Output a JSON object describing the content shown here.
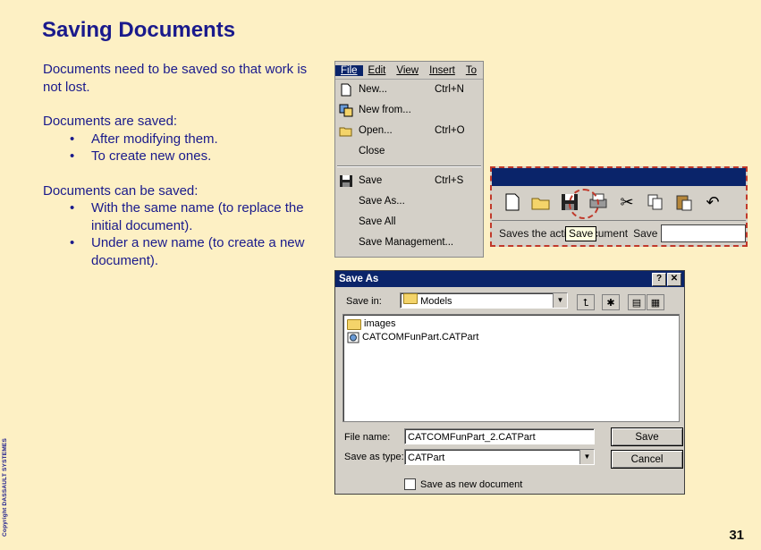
{
  "slide": {
    "title": "Saving Documents",
    "intro": "Documents need to be saved so that work is not lost.",
    "saved_heading": "Documents are saved:",
    "saved_bullets": [
      "After modifying them.",
      "To create new ones."
    ],
    "can_heading": "Documents can be saved:",
    "can_bullets": [
      "With the same name (to replace the initial document).",
      "Under a new name (to create a new document)."
    ],
    "copyright": "Copyright DASSAULT SYSTEMES",
    "page_number": "31"
  },
  "menu": {
    "bar": [
      "File",
      "Edit",
      "View",
      "Insert",
      "To"
    ],
    "items": [
      {
        "label": "New...",
        "accel": "Ctrl+N"
      },
      {
        "label": "New from...",
        "accel": ""
      },
      {
        "label": "Open...",
        "accel": "Ctrl+O"
      },
      {
        "label": "Close",
        "accel": ""
      },
      {
        "label": "Save",
        "accel": "Ctrl+S"
      },
      {
        "label": "Save As...",
        "accel": ""
      },
      {
        "label": "Save All",
        "accel": ""
      },
      {
        "label": "Save Management...",
        "accel": ""
      }
    ]
  },
  "toolbar": {
    "tooltip": "Save",
    "status_text": "Saves the active document",
    "status_label": "Save"
  },
  "dialog": {
    "title": "Save As",
    "save_in_label": "Save in:",
    "save_in_value": "Models",
    "files": [
      "images",
      "CATCOMFunPart.CATPart"
    ],
    "file_name_label": "File name:",
    "file_name_value": "CATCOMFunPart_2.CATPart",
    "save_type_label": "Save as type:",
    "save_type_value": "CATPart",
    "save_button": "Save",
    "cancel_button": "Cancel",
    "new_doc_checkbox": "Save as new document"
  },
  "colors": {
    "accent": "#0a246a",
    "text": "#1a1a8c",
    "background": "#fdf0c4"
  }
}
